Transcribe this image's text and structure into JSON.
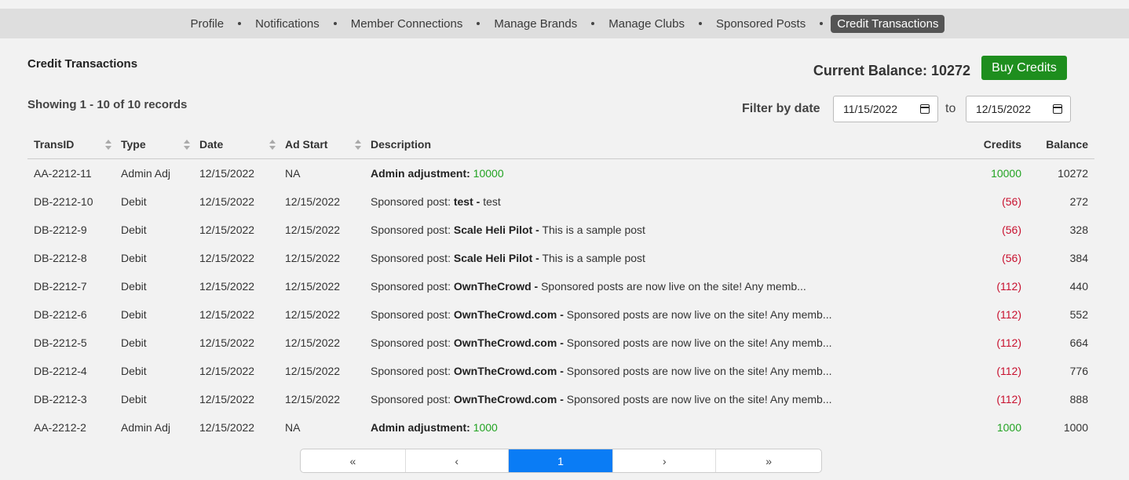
{
  "nav": {
    "items": [
      "Profile",
      "Notifications",
      "Member Connections",
      "Manage Brands",
      "Manage Clubs",
      "Sponsored Posts",
      "Credit Transactions"
    ],
    "active_index": 6
  },
  "page": {
    "title": "Credit Transactions",
    "balance_label": "Current Balance: 10272",
    "buy_label": "Buy Credits",
    "showing": "Showing 1 - 10 of 10 records",
    "filter_label": "Filter by date",
    "from_date": "11/15/2022",
    "to_label": "to",
    "to_date": "12/15/2022"
  },
  "table": {
    "headers": {
      "id": "TransID",
      "type": "Type",
      "date": "Date",
      "start": "Ad Start",
      "desc": "Description",
      "credits": "Credits",
      "balance": "Balance"
    },
    "rows": [
      {
        "id": "AA-2212-11",
        "type": "Admin Adj",
        "date": "12/15/2022",
        "start": "NA",
        "desc_prefix": "",
        "desc_bold": "Admin adjustment:",
        "desc_rest": "",
        "desc_amount": "10000",
        "credits": "10000",
        "credit_kind": "credit",
        "balance": "10272"
      },
      {
        "id": "DB-2212-10",
        "type": "Debit",
        "date": "12/15/2022",
        "start": "12/15/2022",
        "desc_prefix": "Sponsored post:",
        "desc_bold": "test -",
        "desc_rest": "test",
        "desc_amount": "",
        "credits": "(56)",
        "credit_kind": "debit",
        "balance": "272"
      },
      {
        "id": "DB-2212-9",
        "type": "Debit",
        "date": "12/15/2022",
        "start": "12/15/2022",
        "desc_prefix": "Sponsored post:",
        "desc_bold": "Scale Heli Pilot -",
        "desc_rest": "This is a sample post",
        "desc_amount": "",
        "credits": "(56)",
        "credit_kind": "debit",
        "balance": "328"
      },
      {
        "id": "DB-2212-8",
        "type": "Debit",
        "date": "12/15/2022",
        "start": "12/15/2022",
        "desc_prefix": "Sponsored post:",
        "desc_bold": "Scale Heli Pilot -",
        "desc_rest": "This is a sample post",
        "desc_amount": "",
        "credits": "(56)",
        "credit_kind": "debit",
        "balance": "384"
      },
      {
        "id": "DB-2212-7",
        "type": "Debit",
        "date": "12/15/2022",
        "start": "12/15/2022",
        "desc_prefix": "Sponsored post:",
        "desc_bold": "OwnTheCrowd -",
        "desc_rest": "Sponsored posts are now live on the site! Any memb...",
        "desc_amount": "",
        "credits": "(112)",
        "credit_kind": "debit",
        "balance": "440"
      },
      {
        "id": "DB-2212-6",
        "type": "Debit",
        "date": "12/15/2022",
        "start": "12/15/2022",
        "desc_prefix": "Sponsored post:",
        "desc_bold": "OwnTheCrowd.com -",
        "desc_rest": "Sponsored posts are now live on the site! Any memb...",
        "desc_amount": "",
        "credits": "(112)",
        "credit_kind": "debit",
        "balance": "552"
      },
      {
        "id": "DB-2212-5",
        "type": "Debit",
        "date": "12/15/2022",
        "start": "12/15/2022",
        "desc_prefix": "Sponsored post:",
        "desc_bold": "OwnTheCrowd.com -",
        "desc_rest": "Sponsored posts are now live on the site! Any memb...",
        "desc_amount": "",
        "credits": "(112)",
        "credit_kind": "debit",
        "balance": "664"
      },
      {
        "id": "DB-2212-4",
        "type": "Debit",
        "date": "12/15/2022",
        "start": "12/15/2022",
        "desc_prefix": "Sponsored post:",
        "desc_bold": "OwnTheCrowd.com -",
        "desc_rest": "Sponsored posts are now live on the site! Any memb...",
        "desc_amount": "",
        "credits": "(112)",
        "credit_kind": "debit",
        "balance": "776"
      },
      {
        "id": "DB-2212-3",
        "type": "Debit",
        "date": "12/15/2022",
        "start": "12/15/2022",
        "desc_prefix": "Sponsored post:",
        "desc_bold": "OwnTheCrowd.com -",
        "desc_rest": "Sponsored posts are now live on the site! Any memb...",
        "desc_amount": "",
        "credits": "(112)",
        "credit_kind": "debit",
        "balance": "888"
      },
      {
        "id": "AA-2212-2",
        "type": "Admin Adj",
        "date": "12/15/2022",
        "start": "NA",
        "desc_prefix": "",
        "desc_bold": "Admin adjustment:",
        "desc_rest": "",
        "desc_amount": "1000",
        "credits": "1000",
        "credit_kind": "credit",
        "balance": "1000"
      }
    ]
  },
  "pager": {
    "first": "«",
    "prev": "‹",
    "current": "1",
    "next": "›",
    "last": "»"
  },
  "colors": {
    "credit": "#22a322",
    "debit": "#c8102e",
    "buy_button": "#1e8e1e",
    "page_active": "#0a7cf5",
    "nav_active": "#555555"
  }
}
